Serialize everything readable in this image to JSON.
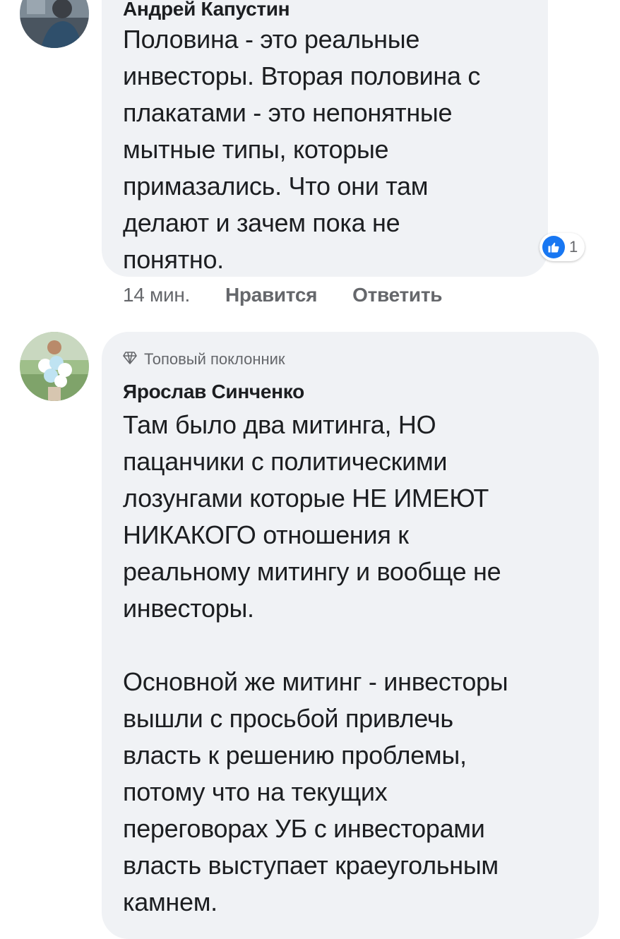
{
  "comments": [
    {
      "author": "Андрей Капустин",
      "text": "Половина - это реальные\nинвесторы. Вторая половина с\nплакатами - это непонятные\nмытные типы, которые\nпримазались. Что они там\nделают и зачем пока не\nпонятно.",
      "reaction": {
        "icon": "like-icon",
        "count": "1",
        "color": "#1877f2"
      },
      "time": "14 мин.",
      "like_label": "Нравится",
      "reply_label": "Ответить"
    },
    {
      "badge": "Топовый поклонник",
      "badge_icon": "diamond-icon",
      "author": "Ярослав Синченко",
      "text": "Там было два митинга, НО\nпацанчики с политическими\nлозунгами которые НЕ ИМЕЮТ\nНИКАКОГО отношения к\nреальному митингу и вообще не\nинвесторы.\n\nОсновной же митинг - инвесторы\nвышли с просьбой привлечь\nвласть к решению проблемы,\nпотому что на текущих\nпереговорах УБ с инвесторами\nвласть выступает краеугольным\nкамнем."
    }
  ],
  "colors": {
    "bubble": "#f0f2f5",
    "text": "#1c1e21",
    "secondary": "#65676b",
    "like": "#1877f2"
  }
}
